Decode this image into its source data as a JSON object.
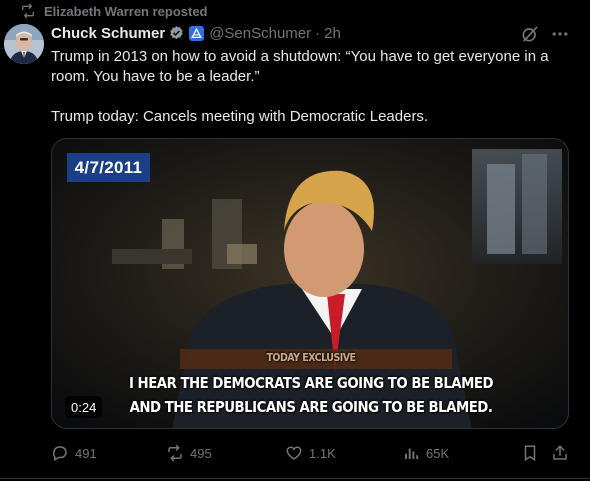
{
  "repost": {
    "text": "Elizabeth Warren reposted"
  },
  "author": {
    "display_name": "Chuck Schumer",
    "handle": "@SenSchumer",
    "separator": "·",
    "time": "2h"
  },
  "tweet": {
    "line1": "Trump in 2013 on how to avoid a shutdown: “You have to get everyone in a",
    "line2": "room. You have to be a leader.”",
    "line3": "Trump today: Cancels meeting with Democratic Leaders."
  },
  "media": {
    "date_badge": "4/7/2011",
    "lower_third": "TODAY EXCLUSIVE",
    "caption_line1": "I HEAR THE DEMOCRATS ARE GOING TO BE BLAMED",
    "caption_line2": "AND THE REPUBLICANS ARE GOING TO BE BLAMED.",
    "duration": "0:24"
  },
  "actions": {
    "replies": "491",
    "reposts": "495",
    "likes": "1.1K",
    "views": "65K"
  },
  "colors": {
    "background": "#000000",
    "text": "#e7e9ea",
    "muted": "#71767b",
    "verified": "#8b98a5",
    "affiliate": "#2f6fe0",
    "date_badge": "#1a3f86"
  },
  "icons": [
    "repost-icon",
    "verified-icon",
    "affiliate-badge-icon",
    "grok-icon",
    "more-icon",
    "reply-icon",
    "retweet-icon",
    "like-icon",
    "views-icon",
    "bookmark-icon",
    "share-icon"
  ]
}
